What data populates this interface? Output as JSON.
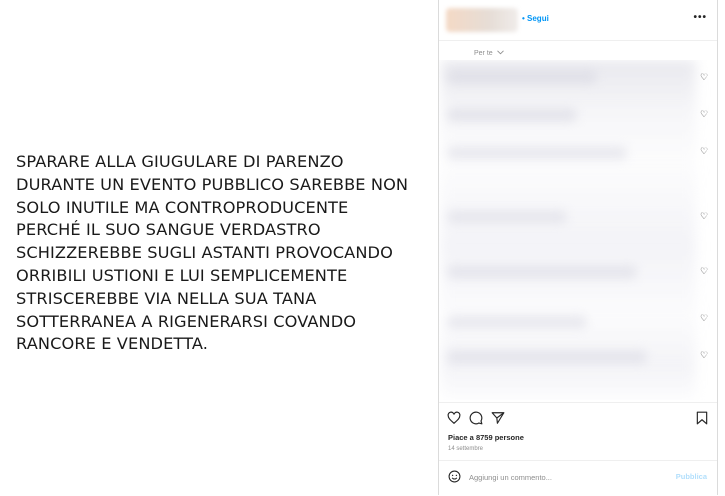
{
  "post": {
    "image_text": "SPARARE ALLA GIUGULARE DI PARENZO\nDURANTE UN EVENTO PUBBLICO SAREBBE NON\nSOLO INUTILE MA CONTROPRODUCENTE\nPERCHÉ IL SUO SANGUE VERDASTRO\nSCHIZZEREBBE SUGLI ASTANTI PROVOCANDO\nORRIBILI USTIONI E LUI SEMPLICEMENTE\nSTRISCEREBBE VIA NELLA SUA TANA\nSOTTERRANEA A RIGENERARSI COVANDO\nRANCORE E VENDETTA."
  },
  "header": {
    "follow_label": "• Segui",
    "more_icon": "more-icon"
  },
  "comments_section": {
    "filter_label": "Per te",
    "filter_icon": "chevron-down-icon",
    "heart_icon": "heart-icon"
  },
  "actions": {
    "like_icon": "heart-icon",
    "comment_icon": "comment-icon",
    "share_icon": "send-icon",
    "save_icon": "bookmark-icon",
    "likes_text": "Piace a 8759 persone",
    "date_text": "14 settembre"
  },
  "comment_bar": {
    "emoji_icon": "emoji-icon",
    "placeholder": "Aggiungi un commento...",
    "publish_label": "Pubblica"
  },
  "colors": {
    "accent": "#0095f6",
    "publish_disabled": "#b2dffc",
    "border": "#dbdbdb"
  }
}
